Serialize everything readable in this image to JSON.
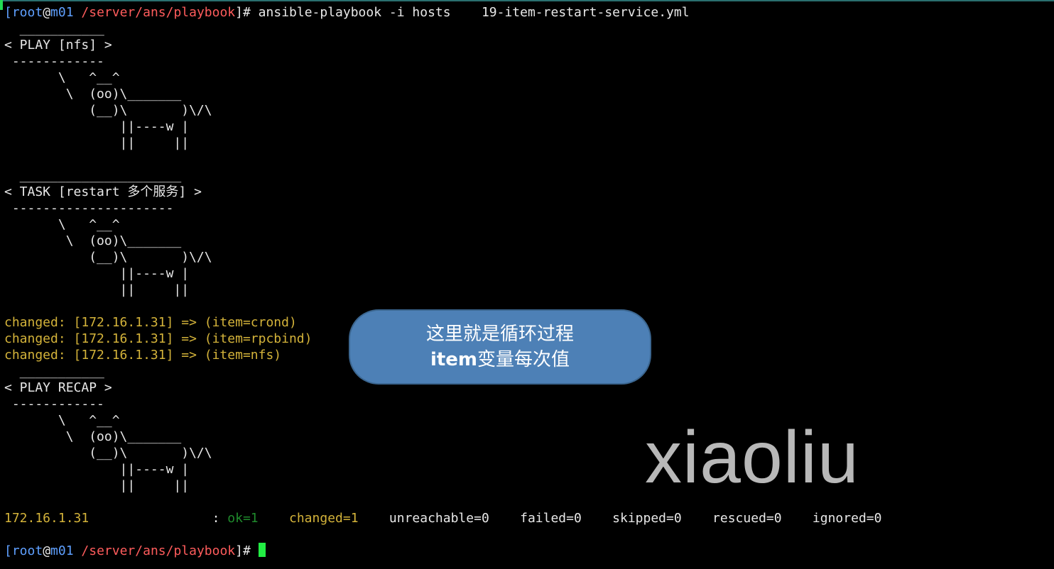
{
  "prompt": {
    "open": "[",
    "user": "root",
    "at": "@",
    "host": "m01",
    "path": "/server/ans/playbook",
    "close": "]#"
  },
  "command": " ansible-playbook -i hosts    19-item-restart-service.yml",
  "cow_art": {
    "line1": "       \\   ^__^",
    "line2": "        \\  (oo)\\_______",
    "line3": "           (__)\\       )\\/\\",
    "line4": "               ||----w |",
    "line5": "               ||     ||"
  },
  "play": {
    "top": "  ___________",
    "title": "< PLAY [nfs] >",
    "bottom": " ------------"
  },
  "task": {
    "top": "  _____________________",
    "title": "< TASK [restart 多个服务] >",
    "bottom": " ---------------------"
  },
  "results": [
    "changed: [172.16.1.31] => (item=crond)",
    "changed: [172.16.1.31] => (item=rpcbind)",
    "changed: [172.16.1.31] => (item=nfs)"
  ],
  "recap": {
    "top": "  ___________",
    "title": "< PLAY RECAP >",
    "bottom": " ------------",
    "host": "172.16.1.31",
    "sep": "                : ",
    "ok": "ok=1",
    "changed": "    changed=1",
    "rest": "    unreachable=0    failed=0    skipped=0    rescued=0    ignored=0"
  },
  "callout": {
    "line1": "这里就是循环过程",
    "line2_bold": "item",
    "line2_rest": "变量每次值"
  },
  "watermark": "xiaoliu",
  "colors": {
    "background": "#000000",
    "prompt_bracket": "#5fa0ff",
    "prompt_path": "#ff5c5c",
    "changed": "#d4b33a",
    "ok": "#1f8a2c",
    "callout_fill": "#4d80b6",
    "cursor": "#22ee44"
  }
}
